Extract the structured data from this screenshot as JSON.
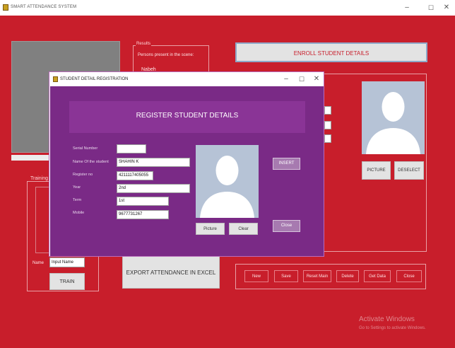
{
  "app": {
    "title": "SMART ATTENDANCE SYSTEM",
    "min": "–",
    "max": "☐",
    "close": "✕"
  },
  "results": {
    "label": "Results",
    "text": "Persons present in the scene:",
    "partial_name": "Nabeh"
  },
  "enroll_button": "ENROLL STUDENT DETAILS",
  "training": {
    "label": "Training",
    "name_label": "Name",
    "name_value": "Input Name",
    "train_button": "TRAIN"
  },
  "export_button": "EXPORT ATTENDANCE IN EXCEL",
  "right_panel": {
    "picture_button": "PICTURE",
    "deselect_button": "DESELECT"
  },
  "bottom_buttons": [
    "New",
    "Save",
    "Reset Main",
    "Delete",
    "Get Data",
    "Close"
  ],
  "watermark": {
    "title": "Activate Windows",
    "subtitle": "Go to Settings to activate Windows."
  },
  "dialog": {
    "title": "STUDENT DETAIL REGISTRATION",
    "min": "–",
    "max": "☐",
    "close": "✕",
    "header": "REGISTER STUDENT DETAILS",
    "fields": [
      {
        "label": "Serial Number",
        "value": ""
      },
      {
        "label": "Name Of the student",
        "value": "SHAHIN K"
      },
      {
        "label": "Register no",
        "value": "4211117405055"
      },
      {
        "label": "Year",
        "value": "2nd"
      },
      {
        "label": "Term",
        "value": "1st"
      },
      {
        "label": "Mobile",
        "value": "9677731267"
      }
    ],
    "insert_button": "INSERT",
    "picture_button": "Picture",
    "clear_button": "Clear",
    "close_button": "Close"
  },
  "colors": {
    "main_background": "#c81e2b",
    "dialog_background": "#7a2a86",
    "header_band": "#8a3496",
    "placeholder_photo": "#b6c3d6"
  }
}
